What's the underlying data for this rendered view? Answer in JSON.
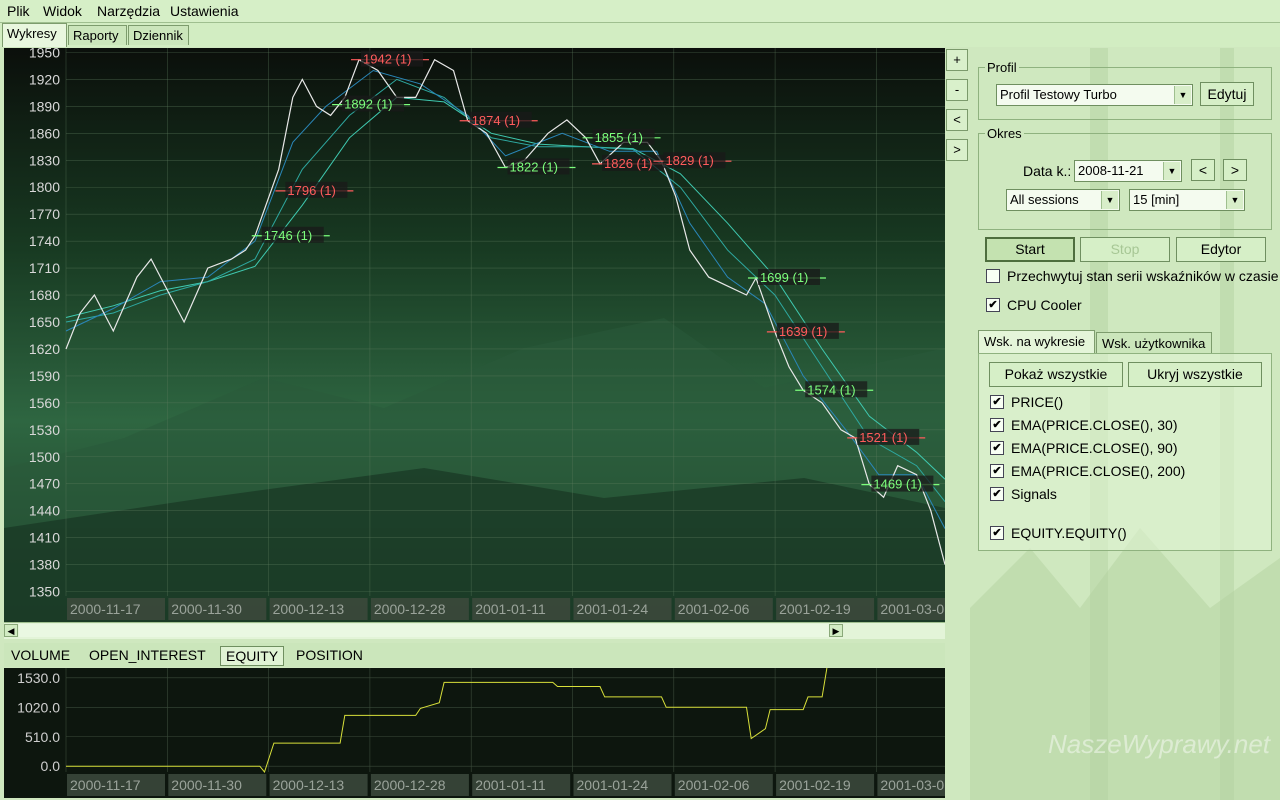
{
  "menu": [
    "Plik",
    "Widok",
    "Narzędzia",
    "Ustawienia"
  ],
  "main_tabs": [
    "Wykresy",
    "Raporty",
    "Dziennik"
  ],
  "side_buttons": [
    "+",
    "-",
    "<",
    ">"
  ],
  "sub_tabs": [
    "VOLUME",
    "OPEN_INTEREST",
    "EQUITY",
    "POSITION"
  ],
  "profile": {
    "legend": "Profil",
    "selected": "Profil Testowy Turbo",
    "edit_label": "Edytuj"
  },
  "period": {
    "legend": "Okres",
    "date_label": "Data k.:",
    "date_value": "2008-11-21",
    "prev": "<",
    "next": ">",
    "sessions": "All sessions",
    "interval": "15 [min]"
  },
  "actions": {
    "start": "Start",
    "stop": "Stop",
    "editor": "Edytor"
  },
  "options": {
    "capture_label": "Przechwytuj stan serii wskaźników w czasie",
    "capture_checked": false,
    "cpu_label": "CPU Cooler",
    "cpu_checked": true
  },
  "indicator_tabs": [
    "Wsk. na wykresie",
    "Wsk. użytkownika"
  ],
  "indicator_buttons": {
    "show_all": "Pokaż wszystkie",
    "hide_all": "Ukryj wszystkie"
  },
  "indicators": [
    {
      "label": "PRICE()",
      "checked": true
    },
    {
      "label": "EMA(PRICE.CLOSE(), 30)",
      "checked": true
    },
    {
      "label": "EMA(PRICE.CLOSE(), 90)",
      "checked": true
    },
    {
      "label": "EMA(PRICE.CLOSE(), 200)",
      "checked": true
    },
    {
      "label": "Signals",
      "checked": true
    },
    {
      "label": "EQUITY.EQUITY()",
      "checked": true
    }
  ],
  "watermark": "NaszeWyprawy.net",
  "chart_data": [
    {
      "type": "line",
      "title": "",
      "x_tick_labels": [
        "2000-11-17",
        "2000-11-30",
        "2000-12-13",
        "2000-12-28",
        "2001-01-11",
        "2001-01-24",
        "2001-02-06",
        "2001-02-19",
        "2001-03-0"
      ],
      "y_ticks": [
        1950,
        1920,
        1890,
        1860,
        1830,
        1800,
        1770,
        1740,
        1710,
        1680,
        1650,
        1620,
        1590,
        1560,
        1530,
        1500,
        1470,
        1440,
        1410,
        1380,
        1350
      ],
      "ylim": [
        1345,
        1955
      ],
      "grid": true,
      "price_path": [
        [
          0,
          1620
        ],
        [
          0.3,
          1660
        ],
        [
          0.6,
          1680
        ],
        [
          1.0,
          1640
        ],
        [
          1.5,
          1700
        ],
        [
          1.8,
          1720
        ],
        [
          2.0,
          1700
        ],
        [
          2.5,
          1650
        ],
        [
          3.0,
          1710
        ],
        [
          3.5,
          1720
        ],
        [
          3.8,
          1730
        ],
        [
          4.0,
          1746
        ],
        [
          4.5,
          1820
        ],
        [
          4.8,
          1900
        ],
        [
          5.0,
          1920
        ],
        [
          5.3,
          1890
        ],
        [
          5.6,
          1880
        ],
        [
          5.9,
          1900
        ],
        [
          6.2,
          1942
        ],
        [
          6.6,
          1930
        ],
        [
          7.0,
          1900
        ],
        [
          7.4,
          1900
        ],
        [
          7.8,
          1942
        ],
        [
          8.2,
          1930
        ],
        [
          8.5,
          1874
        ],
        [
          8.9,
          1860
        ],
        [
          9.3,
          1822
        ],
        [
          9.7,
          1830
        ],
        [
          10.2,
          1860
        ],
        [
          10.6,
          1875
        ],
        [
          11.0,
          1855
        ],
        [
          11.3,
          1826
        ],
        [
          11.8,
          1850
        ],
        [
          12.3,
          1850
        ],
        [
          12.6,
          1829
        ],
        [
          12.9,
          1790
        ],
        [
          13.2,
          1730
        ],
        [
          13.6,
          1700
        ],
        [
          14.0,
          1690
        ],
        [
          14.4,
          1680
        ],
        [
          14.6,
          1699
        ],
        [
          15.0,
          1639
        ],
        [
          15.3,
          1600
        ],
        [
          15.6,
          1574
        ],
        [
          16.0,
          1560
        ],
        [
          16.4,
          1530
        ],
        [
          16.7,
          1521
        ],
        [
          17.0,
          1469
        ],
        [
          17.3,
          1455
        ],
        [
          17.6,
          1490
        ],
        [
          18.0,
          1480
        ],
        [
          18.3,
          1440
        ],
        [
          18.6,
          1380
        ]
      ],
      "ema_30": [
        [
          0,
          1640
        ],
        [
          1,
          1665
        ],
        [
          2,
          1695
        ],
        [
          3,
          1700
        ],
        [
          4,
          1740
        ],
        [
          4.8,
          1850
        ],
        [
          5.5,
          1890
        ],
        [
          6.5,
          1930
        ],
        [
          7.5,
          1915
        ],
        [
          8.5,
          1880
        ],
        [
          9.3,
          1835
        ],
        [
          10.5,
          1860
        ],
        [
          11.5,
          1840
        ],
        [
          12.5,
          1840
        ],
        [
          13.2,
          1760
        ],
        [
          14.0,
          1700
        ],
        [
          14.8,
          1670
        ],
        [
          15.6,
          1590
        ],
        [
          16.5,
          1530
        ],
        [
          17.2,
          1480
        ],
        [
          18.0,
          1480
        ],
        [
          18.6,
          1420
        ]
      ],
      "ema_90": [
        [
          0,
          1650
        ],
        [
          1,
          1660
        ],
        [
          2,
          1680
        ],
        [
          3,
          1695
        ],
        [
          4,
          1720
        ],
        [
          5,
          1820
        ],
        [
          6,
          1880
        ],
        [
          7,
          1920
        ],
        [
          8,
          1900
        ],
        [
          9,
          1855
        ],
        [
          10,
          1845
        ],
        [
          11,
          1845
        ],
        [
          12,
          1842
        ],
        [
          13,
          1800
        ],
        [
          14,
          1730
        ],
        [
          15,
          1680
        ],
        [
          16,
          1600
        ],
        [
          17,
          1520
        ],
        [
          18,
          1490
        ],
        [
          18.6,
          1450
        ]
      ],
      "ema_200": [
        [
          0,
          1655
        ],
        [
          1,
          1668
        ],
        [
          2,
          1685
        ],
        [
          3,
          1695
        ],
        [
          4,
          1712
        ],
        [
          5,
          1780
        ],
        [
          6,
          1855
        ],
        [
          7,
          1900
        ],
        [
          8,
          1895
        ],
        [
          9,
          1860
        ],
        [
          10,
          1848
        ],
        [
          11,
          1845
        ],
        [
          12,
          1843
        ],
        [
          13,
          1815
        ],
        [
          14,
          1760
        ],
        [
          15,
          1700
        ],
        [
          16,
          1620
        ],
        [
          17,
          1545
        ],
        [
          18,
          1505
        ],
        [
          18.6,
          1475
        ]
      ],
      "signals": [
        {
          "label": "1942 (1)",
          "x": 6.2,
          "y": 1942,
          "side": "short"
        },
        {
          "label": "1892 (1)",
          "x": 5.8,
          "y": 1892,
          "side": "long"
        },
        {
          "label": "1796 (1)",
          "x": 4.6,
          "y": 1796,
          "side": "short"
        },
        {
          "label": "1746 (1)",
          "x": 4.1,
          "y": 1746,
          "side": "long"
        },
        {
          "label": "1874 (1)",
          "x": 8.5,
          "y": 1874,
          "side": "short"
        },
        {
          "label": "1822 (1)",
          "x": 9.3,
          "y": 1822,
          "side": "long"
        },
        {
          "label": "1855 (1)",
          "x": 11.1,
          "y": 1855,
          "side": "long"
        },
        {
          "label": "1826 (1)",
          "x": 11.3,
          "y": 1826,
          "side": "short"
        },
        {
          "label": "1829 (1)",
          "x": 12.6,
          "y": 1829,
          "side": "short"
        },
        {
          "label": "1699 (1)",
          "x": 14.6,
          "y": 1699,
          "side": "long"
        },
        {
          "label": "1639 (1)",
          "x": 15.0,
          "y": 1639,
          "side": "short"
        },
        {
          "label": "1574 (1)",
          "x": 15.6,
          "y": 1574,
          "side": "long"
        },
        {
          "label": "1521 (1)",
          "x": 16.7,
          "y": 1521,
          "side": "short"
        },
        {
          "label": "1469 (1)",
          "x": 17.0,
          "y": 1469,
          "side": "long"
        }
      ]
    },
    {
      "type": "line",
      "title": "",
      "x_tick_labels": [
        "2000-11-17",
        "2000-11-30",
        "2000-12-13",
        "2000-12-28",
        "2001-01-11",
        "2001-01-24",
        "2001-02-06",
        "2001-02-19",
        "2001-03-0"
      ],
      "y_ticks": [
        1530.0,
        1020.0,
        510.0,
        0.0
      ],
      "y_tick_labels": [
        "1530.0",
        "1020.0",
        "510.0",
        "0.0"
      ],
      "ylim": [
        -100,
        1700
      ],
      "series": [
        {
          "values": [
            [
              0,
              0
            ],
            [
              2,
              0
            ],
            [
              4.1,
              0
            ],
            [
              4.2,
              -100
            ],
            [
              4.4,
              400
            ],
            [
              5.8,
              400
            ],
            [
              5.9,
              880
            ],
            [
              7.4,
              880
            ],
            [
              7.5,
              1000
            ],
            [
              7.9,
              1100
            ],
            [
              8.0,
              1450
            ],
            [
              10.3,
              1450
            ],
            [
              10.4,
              1380
            ],
            [
              11.3,
              1380
            ],
            [
              11.4,
              1200
            ],
            [
              12.6,
              1200
            ],
            [
              12.7,
              1020
            ],
            [
              14.4,
              1020
            ],
            [
              14.5,
              480
            ],
            [
              14.8,
              650
            ],
            [
              14.9,
              980
            ],
            [
              15.6,
              980
            ],
            [
              15.7,
              1200
            ],
            [
              16.0,
              1200
            ],
            [
              16.1,
              1700
            ]
          ],
          "color": "#d8e03a"
        }
      ]
    }
  ]
}
